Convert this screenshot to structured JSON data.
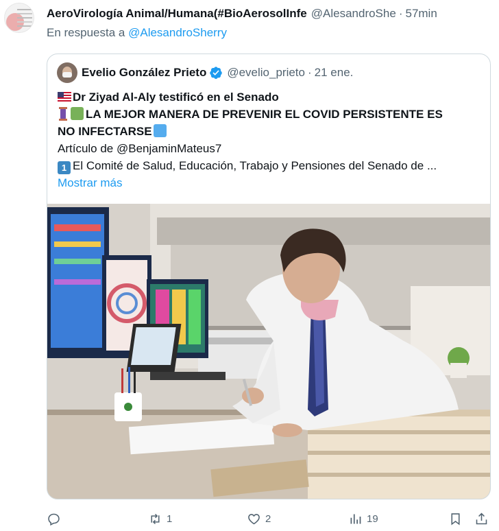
{
  "tweet": {
    "author_name": "AeroVirología Animal/Humana(#BioAerosolInfe",
    "author_handle": "@AlesandroShe",
    "time": "57min",
    "reply_prefix": "En respuesta a",
    "reply_to": "@AlesandroSherry"
  },
  "quote": {
    "author_name": "Evelio González Prieto",
    "author_handle": "@evelio_prieto",
    "date": "21 ene.",
    "line1": "Dr Ziyad Al-Aly testificó en el Senado",
    "line2": "LA MEJOR MANERA DE PREVENIR EL COVID PERSISTENTE ES",
    "line3": "NO INFECTARSE",
    "line4": "Artículo de @BenjaminMateus7",
    "keycap": "1",
    "line5": "El Comité de Salud, Educación, Trabajo y Pensiones del Senado de ...",
    "show_more": "Mostrar más"
  },
  "actions": {
    "reply_count": "",
    "retweet_count": "1",
    "like_count": "2",
    "views_count": "19"
  },
  "colors": {
    "accent": "#1d9bf0",
    "muted_text": "#536471",
    "border": "#cfd9de"
  }
}
